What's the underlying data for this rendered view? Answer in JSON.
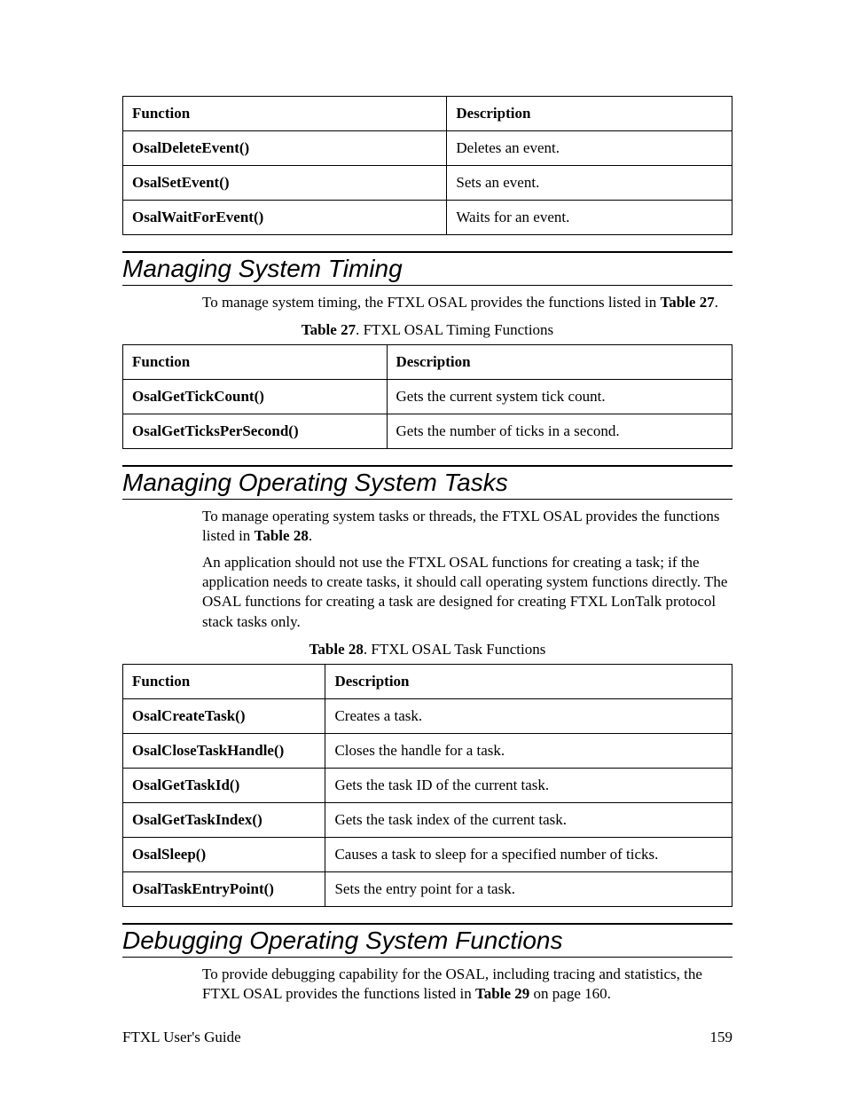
{
  "tables": {
    "events": {
      "headers": {
        "fn": "Function",
        "desc": "Description"
      },
      "rows": [
        {
          "fn": "OsalDeleteEvent()",
          "desc": "Deletes an event."
        },
        {
          "fn": "OsalSetEvent()",
          "desc": "Sets an event."
        },
        {
          "fn": "OsalWaitForEvent()",
          "desc": "Waits for an event."
        }
      ]
    },
    "timing": {
      "caption_label": "Table 27",
      "caption_rest": ". FTXL OSAL Timing Functions",
      "headers": {
        "fn": "Function",
        "desc": "Description"
      },
      "rows": [
        {
          "fn": "OsalGetTickCount()",
          "desc": "Gets the current system tick count."
        },
        {
          "fn": "OsalGetTicksPerSecond()",
          "desc": "Gets the number of ticks in a second."
        }
      ]
    },
    "tasks": {
      "caption_label": "Table 28",
      "caption_rest": ". FTXL OSAL Task Functions",
      "headers": {
        "fn": "Function",
        "desc": "Description"
      },
      "rows": [
        {
          "fn": "OsalCreateTask()",
          "desc": "Creates a task."
        },
        {
          "fn": "OsalCloseTaskHandle()",
          "desc": "Closes the handle for a task."
        },
        {
          "fn": "OsalGetTaskId()",
          "desc": "Gets the task ID of the current task."
        },
        {
          "fn": "OsalGetTaskIndex()",
          "desc": "Gets the task index of the current task."
        },
        {
          "fn": "OsalSleep()",
          "desc": "Causes a task to sleep for a specified number of ticks."
        },
        {
          "fn": "OsalTaskEntryPoint()",
          "desc": "Sets the entry point for a task."
        }
      ]
    }
  },
  "sections": {
    "timing": {
      "heading": "Managing System Timing",
      "para_pre": "To manage system timing, the FTXL OSAL provides the functions listed in ",
      "para_ref": "Table 27",
      "para_post": "."
    },
    "tasks": {
      "heading": "Managing Operating System Tasks",
      "para1_pre": "To manage operating system tasks or threads, the FTXL OSAL provides the functions listed in ",
      "para1_ref": "Table 28",
      "para1_post": ".",
      "para2": "An application should not use the FTXL OSAL functions for creating a task; if the application needs to create tasks, it should call operating system functions directly.  The OSAL functions for creating a task are designed for creating FTXL LonTalk protocol stack tasks only."
    },
    "debug": {
      "heading": "Debugging Operating System Functions",
      "para_pre": "To provide debugging capability for the OSAL, including tracing and statistics, the FTXL OSAL provides the functions listed in ",
      "para_ref": "Table 29",
      "para_post": " on page 160."
    }
  },
  "footer": {
    "left": "FTXL User's Guide",
    "right": "159"
  }
}
